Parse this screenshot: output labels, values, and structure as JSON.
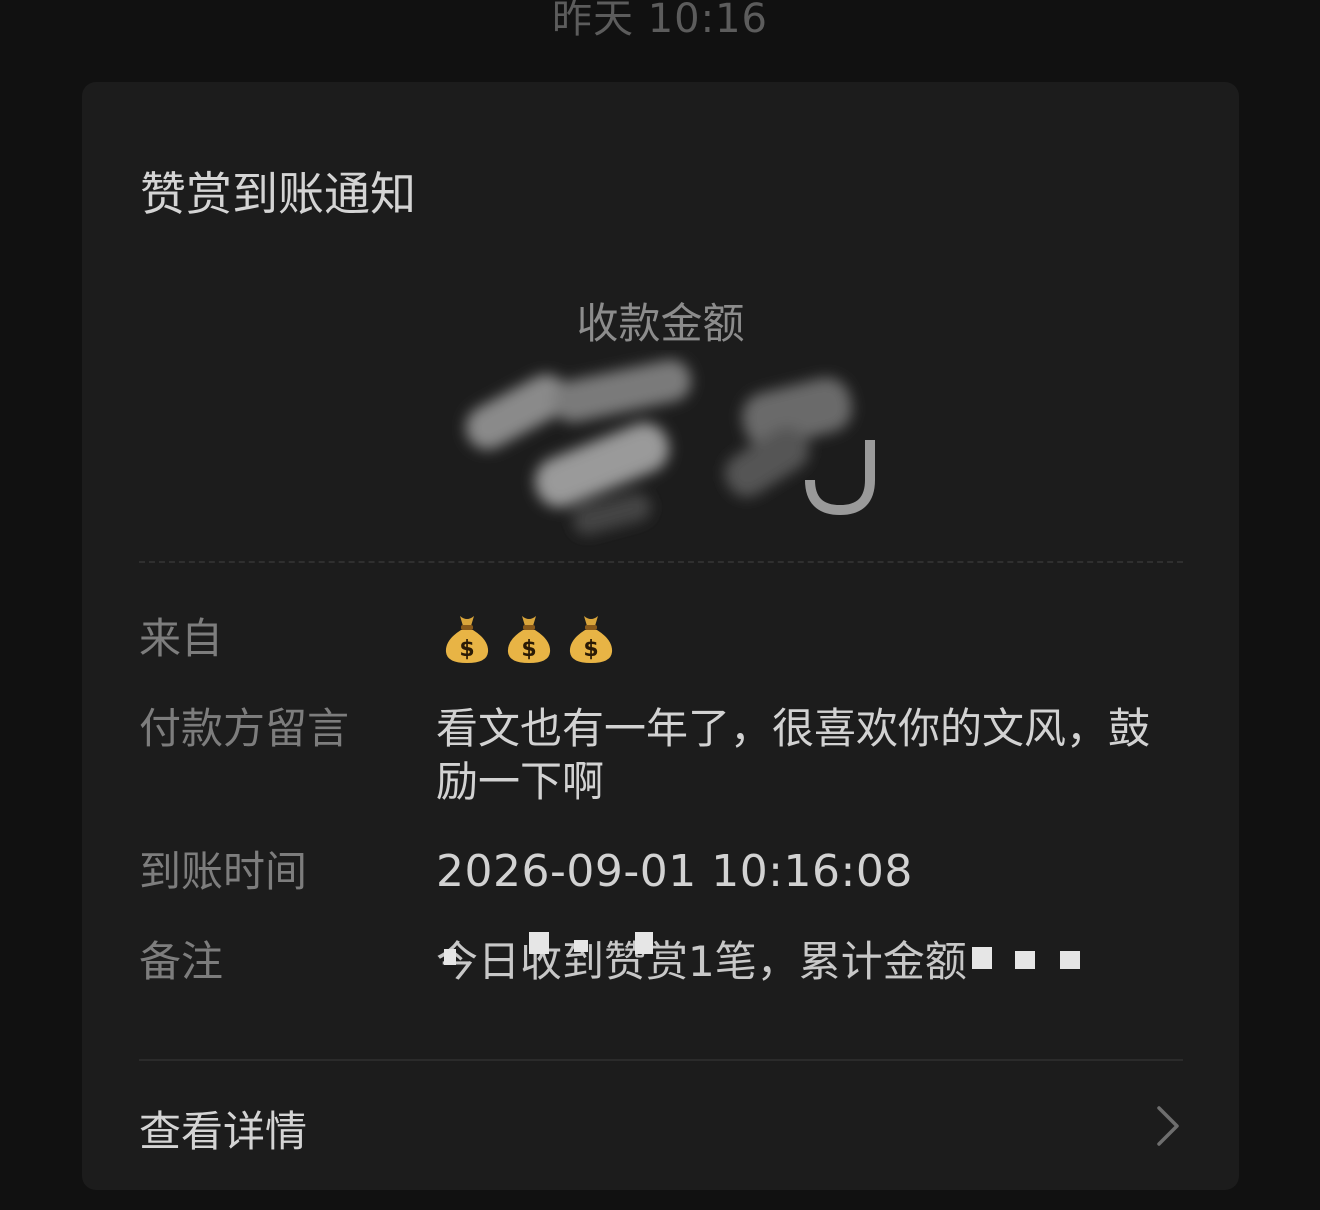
{
  "header": {
    "timestamp": "昨天 10:16"
  },
  "card": {
    "title": "赞赏到账通知",
    "amount_label": "收款金额",
    "rows": {
      "from": {
        "label": "来自",
        "icons": [
          "money-bag-icon",
          "money-bag-icon",
          "money-bag-icon"
        ]
      },
      "message": {
        "label": "付款方留言",
        "value": "看文也有一年了，很喜欢你的文风，鼓励一下啊"
      },
      "arrival_time": {
        "label": "到账时间",
        "value": "2026-09-01 10:16:08"
      },
      "note": {
        "label": "备注",
        "value": "今日收到赞赏1笔，累计金额"
      }
    },
    "details": {
      "label": "查看详情"
    }
  },
  "colors": {
    "background": "#111111",
    "card": "#1c1c1c",
    "label": "#7d7d7d",
    "value": "#d2d2d2"
  }
}
